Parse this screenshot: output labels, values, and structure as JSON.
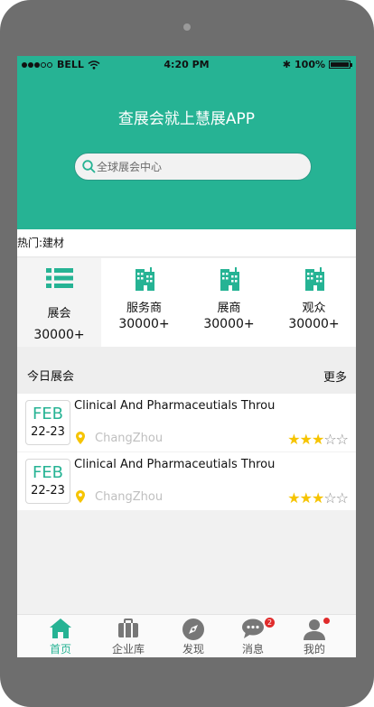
{
  "status": {
    "carrier": "BELL",
    "time": "4:20 PM",
    "battery": "100%"
  },
  "hero": {
    "title": "查展会就上慧展APP",
    "search_placeholder": "全球展会中心"
  },
  "hot": {
    "label": "热门:建材"
  },
  "categories": [
    {
      "label": "展会",
      "count": "30000+",
      "icon": "list-icon"
    },
    {
      "label": "服务商",
      "count": "30000+",
      "icon": "building-icon"
    },
    {
      "label": "展商",
      "count": "30000+",
      "icon": "building-icon"
    },
    {
      "label": "观众",
      "count": "30000+",
      "icon": "building-icon"
    }
  ],
  "section": {
    "title": "今日展会",
    "more": "更多"
  },
  "exhibitions": [
    {
      "month": "FEB",
      "days": "22-23",
      "title": "Clinical And Pharmaceutials Throu",
      "location": "ChangZhou",
      "rating": 3,
      "max_rating": 5
    },
    {
      "month": "FEB",
      "days": "22-23",
      "title": "Clinical And Pharmaceutials Throu",
      "location": "ChangZhou",
      "rating": 3,
      "max_rating": 5
    }
  ],
  "tabs": [
    {
      "label": "首页",
      "icon": "home-icon"
    },
    {
      "label": "企业库",
      "icon": "briefcase-icon"
    },
    {
      "label": "发现",
      "icon": "compass-icon"
    },
    {
      "label": "消息",
      "icon": "chat-icon",
      "badge": "2"
    },
    {
      "label": "我的",
      "icon": "user-icon"
    }
  ],
  "colors": {
    "accent": "#26b394",
    "star": "#f6c400",
    "badge": "#e02b2b"
  }
}
